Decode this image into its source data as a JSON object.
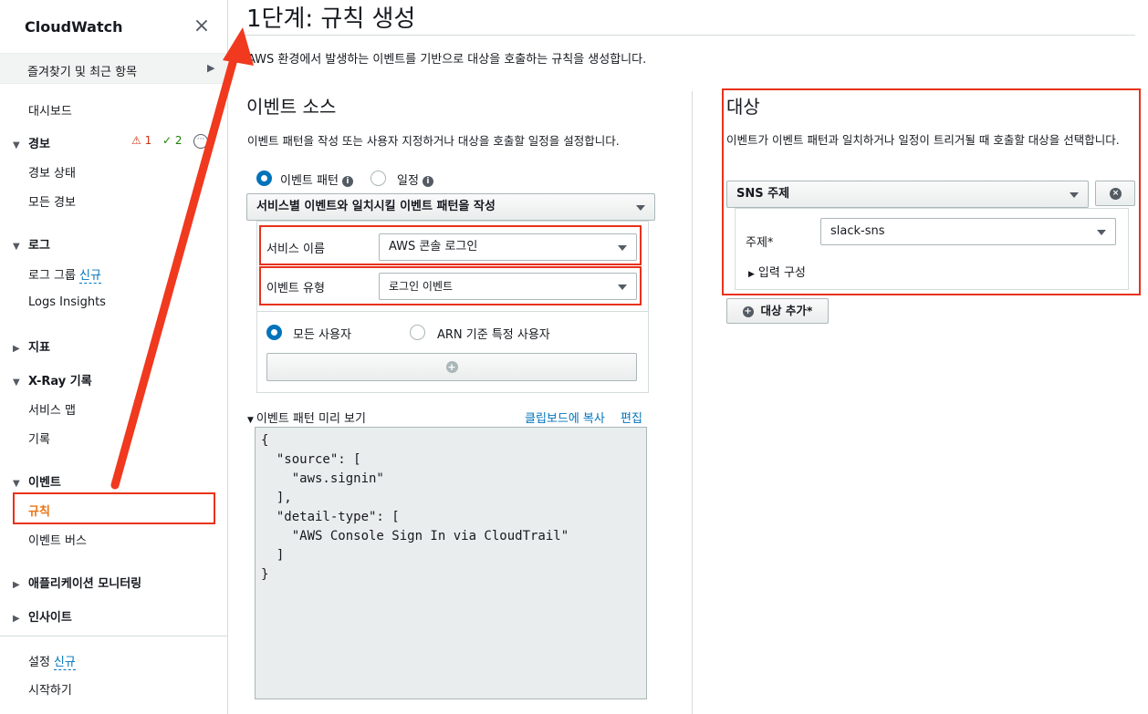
{
  "sidebar": {
    "title": "CloudWatch",
    "close": "×",
    "favorites": "즐겨찾기 및 최근 항목",
    "dashboard": "대시보드",
    "alarms": {
      "label": "경보",
      "warn_count": "1",
      "ok_count": "2",
      "items": [
        "경보 상태",
        "모든 경보"
      ]
    },
    "logs": {
      "label": "로그",
      "items": [
        "로그 그룹",
        "Logs Insights"
      ],
      "new_badge": "신규"
    },
    "metrics": "지표",
    "xray": {
      "label": "X-Ray 기록",
      "items": [
        "서비스 맵",
        "기록"
      ]
    },
    "events": {
      "label": "이벤트",
      "items": [
        "규칙",
        "이벤트 버스"
      ]
    },
    "app_monitoring": "애플리케이션 모니터링",
    "insights": "인사이트",
    "settings": "설정",
    "settings_badge": "신규",
    "get_started": "시작하기"
  },
  "main": {
    "title": "1단계: 규칙 생성",
    "description": "AWS 환경에서 발생하는 이벤트를 기반으로 대상을 호출하는 규칙을 생성합니다.",
    "event_source": {
      "title": "이벤트 소스",
      "description": "이벤트 패턴을 작성 또는 사용자 지정하거나 대상을 호출할 일정을 설정합니다.",
      "radio_pattern": "이벤트 패턴",
      "radio_schedule": "일정",
      "pattern_mode": "서비스별 이벤트와 일치시킬 이벤트 패턴을 작성",
      "service_name_label": "서비스 이름",
      "service_name_value": "AWS 콘솔 로그인",
      "event_type_label": "이벤트 유형",
      "event_type_value": "로그인 이벤트",
      "radio_all_users": "모든 사용자",
      "radio_specific_user": "ARN 기준 특정 사용자",
      "add_icon": "+",
      "preview_label": "이벤트 패턴 미리 보기",
      "copy_link": "클립보드에 복사",
      "edit_link": "편집",
      "preview_code": "{\n  \"source\": [\n    \"aws.signin\"\n  ],\n  \"detail-type\": [\n    \"AWS Console Sign In via CloudTrail\"\n  ]\n}"
    },
    "targets": {
      "title": "대상",
      "description": "이벤트가 이벤트 패턴과 일치하거나 일정이 트리거될 때 호출할 대상을 선택합니다.",
      "target_type": "SNS 주제",
      "topic_label": "주제*",
      "topic_value": "slack-sns",
      "input_config": "입력 구성",
      "add_target": "대상 추가*"
    }
  }
}
